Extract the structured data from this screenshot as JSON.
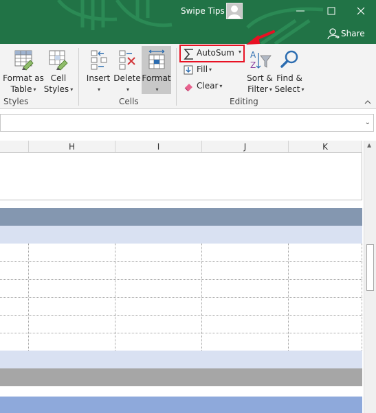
{
  "titlebar": {
    "user_name": "Swipe Tips",
    "share_label": "Share",
    "accent": "#217346"
  },
  "ribbon": {
    "styles_group": {
      "format_as_table": [
        "Format as",
        "Table"
      ],
      "cell_styles": [
        "Cell",
        "Styles"
      ],
      "label": "Styles"
    },
    "cells_group": {
      "insert": "Insert",
      "delete": "Delete",
      "format": "Format",
      "label": "Cells"
    },
    "editing_group": {
      "autosum": "AutoSum",
      "fill": "Fill",
      "clear": "Clear",
      "sort_filter": [
        "Sort &",
        "Filter"
      ],
      "find_select": [
        "Find &",
        "Select"
      ],
      "label": "Editing"
    }
  },
  "annotation": {
    "highlight_color": "#e81123"
  },
  "sheet": {
    "columns": [
      "H",
      "I",
      "J",
      "K"
    ],
    "band_colors": {
      "header_band": "#8497b0",
      "light_band": "#d9e1f2",
      "gray_band": "#a6a6a6",
      "blue_band": "#8ea9db"
    }
  }
}
